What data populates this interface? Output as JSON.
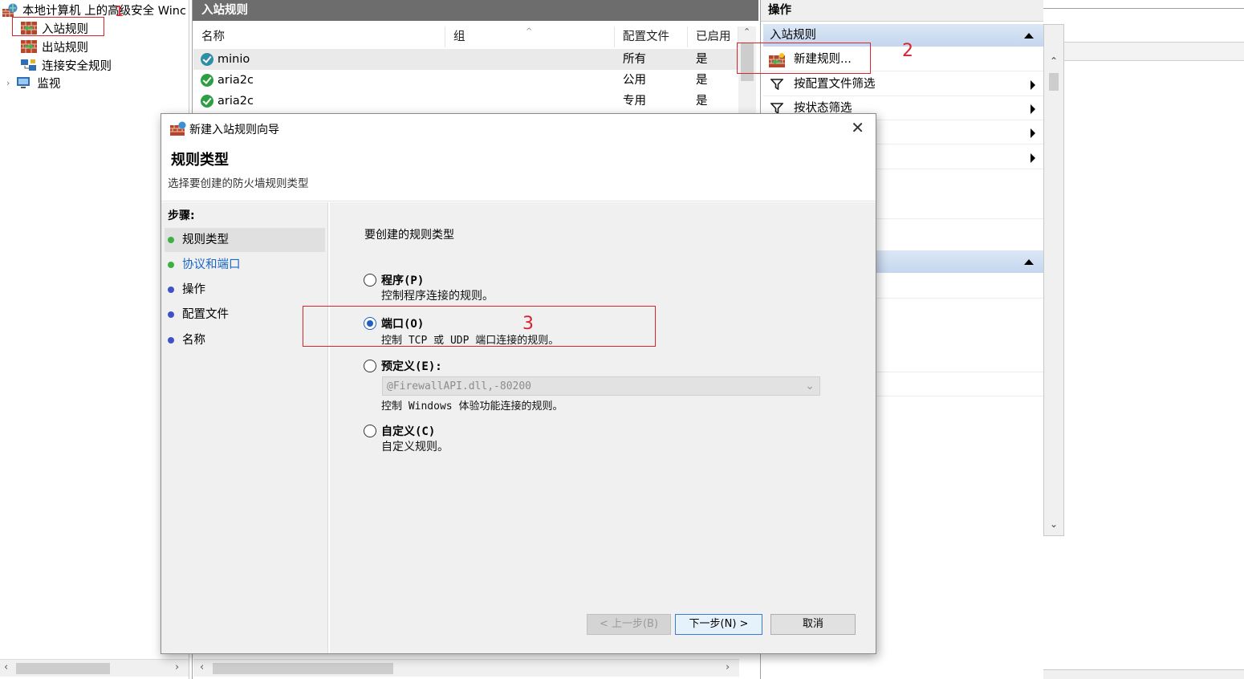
{
  "tree": {
    "root_label": "本地计算机 上的高级安全 Winc",
    "items": [
      {
        "label": "入站规则"
      },
      {
        "label": "出站规则"
      },
      {
        "label": "连接安全规则"
      },
      {
        "label": "监视"
      }
    ]
  },
  "middle": {
    "title": "入站规则",
    "columns": [
      "名称",
      "组",
      "配置文件",
      "已启用"
    ],
    "rows": [
      {
        "name": "minio",
        "group": "",
        "profile": "所有",
        "enabled": "是"
      },
      {
        "name": "aria2c",
        "group": "",
        "profile": "公用",
        "enabled": "是"
      },
      {
        "name": "aria2c",
        "group": "",
        "profile": "专用",
        "enabled": "是"
      }
    ]
  },
  "actions": {
    "title": "操作",
    "section1_label": "入站规则",
    "items": [
      {
        "label": "新建规则..."
      },
      {
        "label": "按配置文件筛选"
      },
      {
        "label": "按状态筛选"
      }
    ]
  },
  "dialog": {
    "title": "新建入站规则向导",
    "heading": "规则类型",
    "subheading": "选择要创建的防火墙规则类型",
    "steps_label": "步骤:",
    "steps": [
      {
        "label": "规则类型",
        "dot_color": "#3cb043"
      },
      {
        "label": "协议和端口",
        "dot_color": "#3cb043"
      },
      {
        "label": "操作",
        "dot_color": "#3f51c9"
      },
      {
        "label": "配置文件",
        "dot_color": "#3f51c9"
      },
      {
        "label": "名称",
        "dot_color": "#3f51c9"
      }
    ],
    "prompt": "要创建的规则类型",
    "options": [
      {
        "label": "程序(P)",
        "desc": "控制程序连接的规则。",
        "selected": false
      },
      {
        "label": "端口(O)",
        "desc": "控制 TCP 或 UDP 端口连接的规则。",
        "selected": true
      },
      {
        "label": "预定义(E):",
        "desc": "控制 Windows 体验功能连接的规则。",
        "selected": false
      },
      {
        "label": "自定义(C)",
        "desc": "自定义规则。",
        "selected": false
      }
    ],
    "predefined_select_value": "@FirewallAPI.dll,-80200",
    "buttons": {
      "back": "< 上一步(B)",
      "next": "下一步(N) >",
      "cancel": "取消"
    },
    "close_glyph": "✕"
  },
  "annotations": [
    "1",
    "2",
    "3"
  ],
  "colors": {
    "annotation": "#d9232d",
    "selected_radio": "#1f5fbf",
    "link": "#1a66c7"
  }
}
